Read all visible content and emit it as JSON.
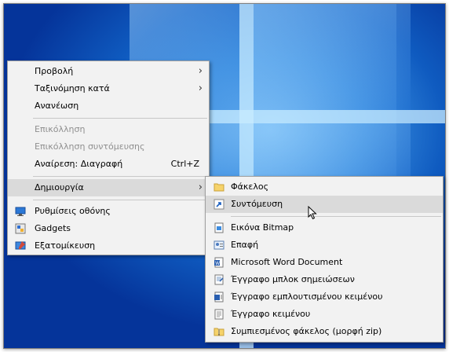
{
  "context_menu": {
    "items": [
      {
        "label": "Προβολή",
        "submenu": true
      },
      {
        "label": "Ταξινόμηση κατά",
        "submenu": true
      },
      {
        "label": "Ανανέωση"
      },
      {
        "label": "Επικόλληση",
        "disabled": true
      },
      {
        "label": "Επικόλληση συντόμευσης",
        "disabled": true
      },
      {
        "label": "Αναίρεση: Διαγραφή",
        "shortcut": "Ctrl+Z"
      },
      {
        "label": "Δημιουργία",
        "submenu": true,
        "highlighted": true
      },
      {
        "label": "Ρυθμίσεις οθόνης",
        "icon": "display-settings-icon"
      },
      {
        "label": "Gadgets",
        "icon": "gadgets-icon"
      },
      {
        "label": "Εξατομίκευση",
        "icon": "personalize-icon"
      }
    ]
  },
  "new_submenu": {
    "items": [
      {
        "label": "Φάκελος",
        "icon": "folder-icon"
      },
      {
        "label": "Συντόμευση",
        "icon": "shortcut-icon",
        "highlighted": true
      },
      {
        "label": "Εικόνα Bitmap",
        "icon": "bitmap-icon"
      },
      {
        "label": "Επαφή",
        "icon": "contact-icon"
      },
      {
        "label": "Microsoft Word Document",
        "icon": "word-icon"
      },
      {
        "label": "Έγγραφο μπλοκ σημειώσεων",
        "icon": "journal-icon"
      },
      {
        "label": "Έγγραφο εμπλουτισμένου κειμένου",
        "icon": "rtf-icon"
      },
      {
        "label": "Έγγραφο κειμένου",
        "icon": "text-document-icon"
      },
      {
        "label": "Συμπιεσμένος φάκελος (μορφή zip)",
        "icon": "zip-folder-icon"
      }
    ]
  },
  "colors": {
    "highlight": "#dadada",
    "menu_bg": "#f2f2f2",
    "disabled_text": "#8f8f8f"
  }
}
